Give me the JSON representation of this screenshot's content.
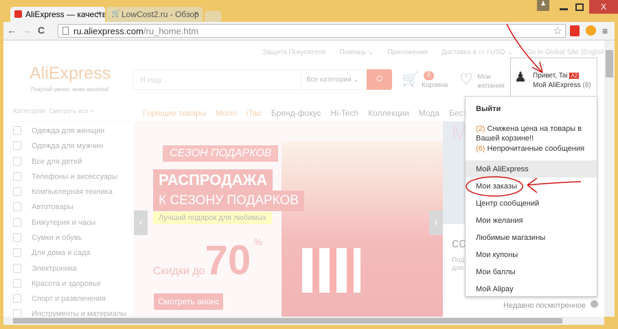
{
  "browser": {
    "tabs": [
      {
        "title": "AliExpress — качестве"
      },
      {
        "title": "LowCost2.ru - Обзор"
      }
    ],
    "url_host": "ru.aliexpress.com",
    "url_path": "/ru_home.htm",
    "close_label": "X"
  },
  "topnav": {
    "items": [
      "Защита Покупателя",
      "Помощь ⌄",
      "Приложения",
      "Доставка в ▭ / USD ⌄",
      "Go to Global Site (English)"
    ]
  },
  "header": {
    "logo": "AliExpress",
    "tagline": "Покупай умнее, живи веселее!",
    "search_placeholder": "Я ищу...",
    "category_select": "Все категории",
    "cart_count": "0",
    "cart_label": "Корзина",
    "wishlist_label_1": "Мои",
    "wishlist_label_2": "желания",
    "greeting": "Привет, Tai",
    "badge": "A2",
    "my_ali": "Мой AliExpress",
    "my_ali_count": "(8)"
  },
  "categories": {
    "title": "Категории",
    "see_all": "Смотреть все >",
    "items": [
      "Одежда для женщин",
      "Одежда для мужчин",
      "Все для детей",
      "Телефоны и аксессуары",
      "Компьютерная техника",
      "Автотовары",
      "Бижутерия и часы",
      "Сумки и обувь",
      "Для дома и сада",
      "Электроника",
      "Красота и здоровье",
      "Спорт и развлечения",
      "Инструменты и материалы"
    ]
  },
  "nav": {
    "items": [
      "Горящие товары",
      "Молл",
      "iTao",
      "Бренд-фокус",
      "Hi-Tech",
      "Коллекции",
      "Мода",
      "Бестселлеры"
    ]
  },
  "banner": {
    "ribbon": "СЕЗОН ПОДАРКОВ",
    "title": "РАСПРОДАЖА",
    "subtitle": "К СЕЗОНУ ПОДАРКОВ",
    "tagline": "Лучший подарок для любимых",
    "discount_prefix": "Скидки до",
    "discount_value": "70",
    "discount_suffix": "%",
    "button": "Смотреть анонс"
  },
  "side": {
    "letter": "M",
    "heading": "со",
    "text1": "Под",
    "text2": "для"
  },
  "menu": {
    "logout": "Выйти",
    "notice1_count": "(2)",
    "notice1": "Снижена цена на товары в Вашей корзине!!",
    "notice2_count": "(6)",
    "notice2": "Непрочитанные сообщения",
    "items": [
      "Мой AliExpress",
      "Мои заказы",
      "Центр сообщений",
      "Мои желания",
      "Любимые магазины",
      "Мои купоны",
      "Мои баллы",
      "Мой Alipay"
    ]
  },
  "recent": "Недавно посмотренное"
}
